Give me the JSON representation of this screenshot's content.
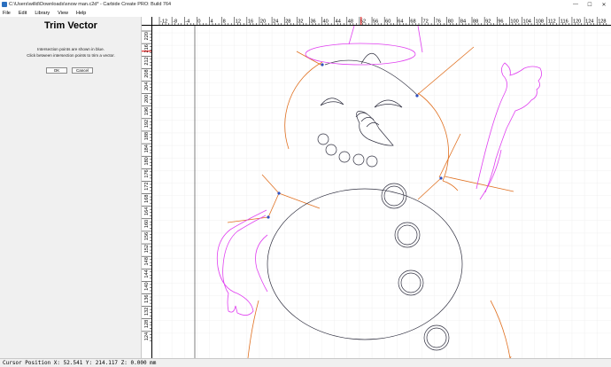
{
  "window": {
    "title": "C:\\Users\\willd\\Downloads\\snow man.c2d* - Carbide Create PRO: Build 764",
    "minimize_glyph": "—",
    "maximize_glyph": "☐",
    "close_glyph": "✕"
  },
  "menu": {
    "items": [
      {
        "label": "File"
      },
      {
        "label": "Edit"
      },
      {
        "label": "Library"
      },
      {
        "label": "View"
      },
      {
        "label": "Help"
      }
    ]
  },
  "panel": {
    "title": "Trim Vector",
    "line1": "Intersection points are shown in blue.",
    "line2": "Click between intersection points to trim a vector.",
    "ok_label": "OK",
    "cancel_label": "Cancel"
  },
  "rulers": {
    "top_labels": [
      "-12",
      "-8",
      "-4",
      "0",
      "4",
      "8",
      "12",
      "16",
      "20",
      "24",
      "28",
      "32",
      "36",
      "40",
      "44",
      "48",
      "52",
      "56",
      "60",
      "64",
      "68",
      "72",
      "76",
      "80",
      "84",
      "88",
      "92",
      "96",
      "100",
      "104",
      "108",
      "112",
      "116",
      "120",
      "124",
      "128"
    ],
    "left_labels": [
      "220",
      "216",
      "212",
      "208",
      "204",
      "200",
      "196",
      "192",
      "188",
      "184",
      "180",
      "176",
      "172",
      "168",
      "164",
      "160",
      "156",
      "152",
      "148",
      "144",
      "140",
      "136",
      "132",
      "128",
      "124"
    ],
    "cursor_x_value": 52.541,
    "cursor_y_value": 214.117
  },
  "status": {
    "text": "Cursor Position X: 52.541 Y: 214.117 Z: 0.000 mm"
  },
  "colors": {
    "guide_orange": "#e07020",
    "outline_magenta": "#e040f0",
    "shape_dark": "#303040",
    "cursor_red": "#e00000",
    "grid_line": "#f0f0f0",
    "panel_bg": "#f0f0f0"
  }
}
